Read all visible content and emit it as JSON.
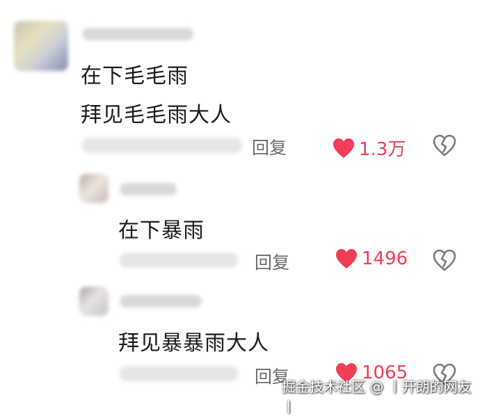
{
  "comments": [
    {
      "lines": [
        "在下毛毛雨",
        "拜见毛毛雨大人"
      ],
      "reply_label": "回复",
      "like_count": "1.3万"
    },
    {
      "lines": [
        "在下暴雨"
      ],
      "reply_label": "回复",
      "like_count": "1496"
    },
    {
      "lines": [
        "拜见暴暴雨大人"
      ],
      "reply_label": "回复",
      "like_count": "1065"
    }
  ],
  "colors": {
    "accent": "#ef3e55",
    "muted": "#6b6b6b"
  },
  "icons": {
    "like": "heart-icon",
    "dislike": "broken-heart-icon"
  },
  "watermark": "掘金技术社区 @ 丨开朗的网友丨"
}
